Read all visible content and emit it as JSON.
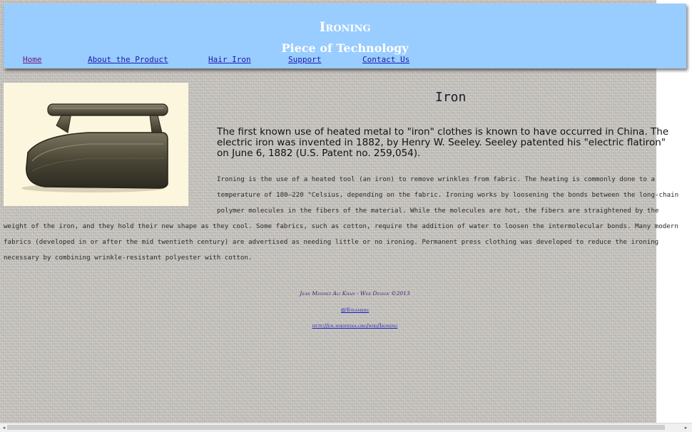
{
  "header": {
    "title": "Ironing",
    "subtitle": "Piece of Technology"
  },
  "nav": {
    "items": [
      {
        "label": "Home"
      },
      {
        "label": "About the Product"
      },
      {
        "label": "Hair Iron"
      },
      {
        "label": "Support"
      },
      {
        "label": "Contact Us"
      }
    ]
  },
  "main": {
    "title": "Iron",
    "intro": "The first known use of heated metal to \"iron\" clothes is known to have occurred in China. The electric iron was invented in 1882, by Henry W. Seeley. Seeley patented his \"electric flatiron\" on June 6, 1882 (U.S. Patent no. 259,054).",
    "body": "Ironing is the use of a heated tool (an iron) to remove wrinkles from fabric. The heating is commonly done to a temperature of 180–220 °Celsius, depending on the fabric. Ironing works by loosening the bonds between the long-chain polymer molecules in the fibers of the material. While the molecules are hot, the fibers are straightened by the weight of the iron, and they hold their new shape as they cool. Some fabrics, such as cotton, require the addition of water to loosen the intermolecular bonds. Many modern fabrics (developed in or after the mid twentieth century) are advertised as needing little or no ironing. Permanent press clothing was developed to reduce the ironing necessary by combining wrinkle-resistant polyester with cotton."
  },
  "footer": {
    "credit": "Jean Mendez Ali Khan - Web Design ©2013",
    "link1": "@Steamers",
    "link2": "http://en.wikipedia.org/wiki/Ironing"
  },
  "colors": {
    "header_bg": "#99ccff",
    "link": "#1a1aa8",
    "visited": "#6b1a7a"
  }
}
